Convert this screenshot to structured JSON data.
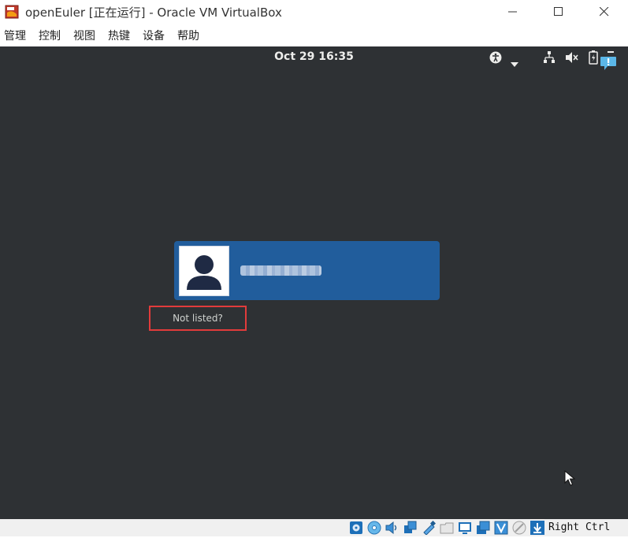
{
  "window": {
    "title": "openEuler [正在运行] - Oracle VM VirtualBox"
  },
  "menu": {
    "items": [
      "管理",
      "控制",
      "视图",
      "热键",
      "设备",
      "帮助"
    ]
  },
  "vm_screen": {
    "clock": "Oct 29  16:35",
    "top_icons": [
      "accessibility-icon",
      "chevron-down-icon",
      "network-icon",
      "volume-muted-icon",
      "battery-icon",
      "notification-icon"
    ],
    "user": {
      "avatar_icon": "user-avatar-icon"
    },
    "not_listed": "Not listed?"
  },
  "statusbar": {
    "host_key": "Right Ctrl",
    "icons": [
      "hard-disk-icon",
      "optical-drive-icon",
      "audio-icon",
      "network-adapter-icon",
      "usb-icon",
      "shared-folders-icon",
      "display-icon",
      "video-capture-icon",
      "virtualization-icon",
      "mouse-integration-icon",
      "host-key-arrow-icon"
    ]
  },
  "colors": {
    "vm_background": "#2e3134",
    "user_card": "#215d9c",
    "highlight_box": "#e23b3b"
  }
}
